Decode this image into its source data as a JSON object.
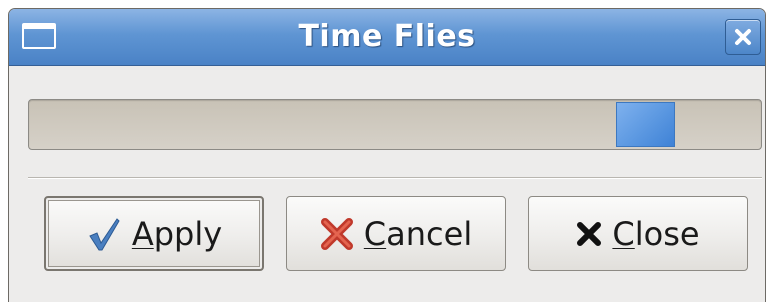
{
  "window": {
    "title": "Time Flies"
  },
  "progress": {
    "pulse_start_fraction": 0.802,
    "pulse_width_fraction": 0.08
  },
  "buttons": {
    "apply": {
      "mnemonic": "A",
      "rest": "pply",
      "icon": "checkmark-icon"
    },
    "cancel": {
      "mnemonic": "C",
      "rest": "ancel",
      "icon": "red-x-icon"
    },
    "close": {
      "mnemonic": "C",
      "rest": "lose",
      "icon": "close-x-icon"
    }
  },
  "colors": {
    "titlebar": "#5f95d3",
    "progress_pulse": "#5e9ae2",
    "cancel_icon": "#c0392b"
  }
}
